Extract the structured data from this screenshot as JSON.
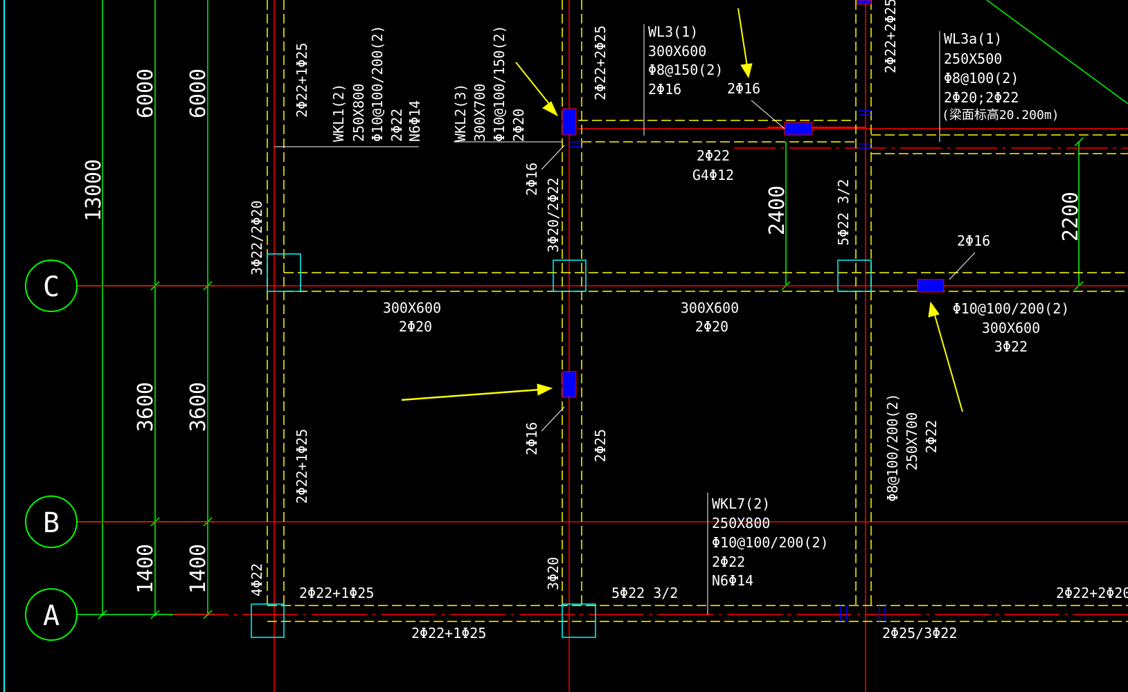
{
  "colors": {
    "background": "#000000",
    "axis_line": "#ff0000",
    "beam_outline": "#ffff00",
    "dimension": "#00ff00",
    "column": "#00ffff",
    "annotation": "#ffffff",
    "highlight": "#0000ff",
    "arrow": "#ffff00"
  },
  "axes": [
    {
      "label": "C",
      "icon": "circle"
    },
    {
      "label": "B",
      "icon": "circle"
    },
    {
      "label": "A",
      "icon": "circle"
    }
  ],
  "dimensions": {
    "outer_total": "13000",
    "inner_col1": [
      "6000",
      "3600",
      "1400"
    ],
    "inner_col2": [
      "6000",
      "3600",
      "1400"
    ],
    "span_mid": "2400",
    "span_right": "2200"
  },
  "annotations": {
    "wkl1": [
      "WKL1(2)",
      "250X800",
      "Φ10@100/200(2)",
      "2Φ22",
      "N6Φ14"
    ],
    "wkl2": [
      "WKL2(3)",
      "300X700",
      "Φ10@100/150(2)",
      "2Φ20"
    ],
    "wl3": [
      "WL3(1)",
      "300X600",
      "Φ8@150(2)",
      "2Φ16"
    ],
    "wl3a": [
      "WL3a(1)",
      "250X500",
      "Φ8@100(2)",
      "2Φ20;2Φ22",
      "(梁面标高20.200m)"
    ],
    "wkl7": [
      "WKL7(2)",
      "250X800",
      "Φ10@100/200(2)",
      "2Φ22",
      "N6Φ14"
    ],
    "right_beam": [
      "Φ10@100/200(2)",
      "300X600",
      "3Φ22"
    ],
    "mid_left": [
      "300X600",
      "2Φ20"
    ],
    "mid_right": [
      "300X600",
      "2Φ20"
    ],
    "top_mid": [
      "2Φ22",
      "G4Φ12"
    ],
    "vbeam_right": [
      "Φ8@100/200(2)",
      "250X700",
      "2Φ22"
    ],
    "rebar_2x16_a": "2Φ16",
    "rebar_2x16_b": "2Φ16",
    "rebar_2x16_c": "2Φ16",
    "rebar_2x16_d": "2Φ16",
    "v_2x22_1x25_top": "2Φ22+1Φ25",
    "v_2x22_2x25_top": "2Φ22+2Φ25",
    "v_2x22_2x25_right": "2Φ22+2Φ25",
    "v_3x22_2x20": "3Φ22/2Φ20",
    "v_3x20_2x22": "3Φ20/2Φ22",
    "v_5x22_32": "5Φ22 3/2",
    "v_2x25": "2Φ25",
    "v_2x22_1x25_mid": "2Φ22+1Φ25",
    "v_4x22": "4Φ22",
    "v_3x20": "3Φ20",
    "h_2x22_1x25_a": "2Φ22+1Φ25",
    "h_5x22_32": "5Φ22 3/2",
    "h_2x22_2x20": "2Φ22+2Φ20",
    "h_2x22_1x25_b": "2Φ22+1Φ25",
    "h_2x25_3x22": "2Φ25/3Φ22"
  }
}
